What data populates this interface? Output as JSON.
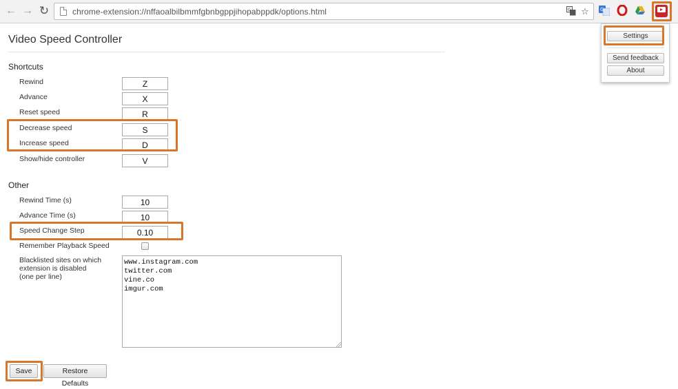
{
  "browser": {
    "url": "chrome-extension://nffaoalbilbmmfgbnbgppjihopabppdk/options.html",
    "nav": {
      "back_glyph": "←",
      "forward_glyph": "→",
      "reload_glyph": "↻"
    },
    "omnibox_icons": [
      "translate-icon",
      "star-icon"
    ],
    "extensions": [
      "google-translate-extension-icon",
      "opera-extension-icon",
      "google-drive-extension-icon",
      "video-speed-controller-extension-icon"
    ]
  },
  "popup": {
    "settings_label": "Settings",
    "feedback_label": "Send feedback",
    "about_label": "About"
  },
  "page": {
    "title": "Video Speed Controller",
    "shortcuts": {
      "heading": "Shortcuts",
      "rows": [
        {
          "label": "Rewind",
          "value": "Z"
        },
        {
          "label": "Advance",
          "value": "X"
        },
        {
          "label": "Reset speed",
          "value": "R"
        },
        {
          "label": "Decrease speed",
          "value": "S"
        },
        {
          "label": "Increase speed",
          "value": "D"
        },
        {
          "label": "Show/hide controller",
          "value": "V"
        }
      ]
    },
    "other": {
      "heading": "Other",
      "rewind_time_label": "Rewind Time (s)",
      "rewind_time_value": "10",
      "advance_time_label": "Advance Time (s)",
      "advance_time_value": "10",
      "speed_step_label": "Speed Change Step",
      "speed_step_value": "0.10",
      "remember_label": "Remember Playback Speed",
      "remember_checked": false,
      "blacklist_label_1": "Blacklisted sites on which",
      "blacklist_label_2": "extension is disabled",
      "blacklist_label_3": "(one per line)",
      "blacklist_value": "www.instagram.com\ntwitter.com\nvine.co\nimgur.com"
    },
    "save_label": "Save",
    "restore_label": "Restore Defaults"
  },
  "colors": {
    "highlight": "#d8762b",
    "opera_red": "#cc1a1a",
    "translate_blue": "#3a78d8",
    "drive_green": "#2d9a4a",
    "drive_yellow": "#f2b01a",
    "extension_red": "#c3272b"
  }
}
